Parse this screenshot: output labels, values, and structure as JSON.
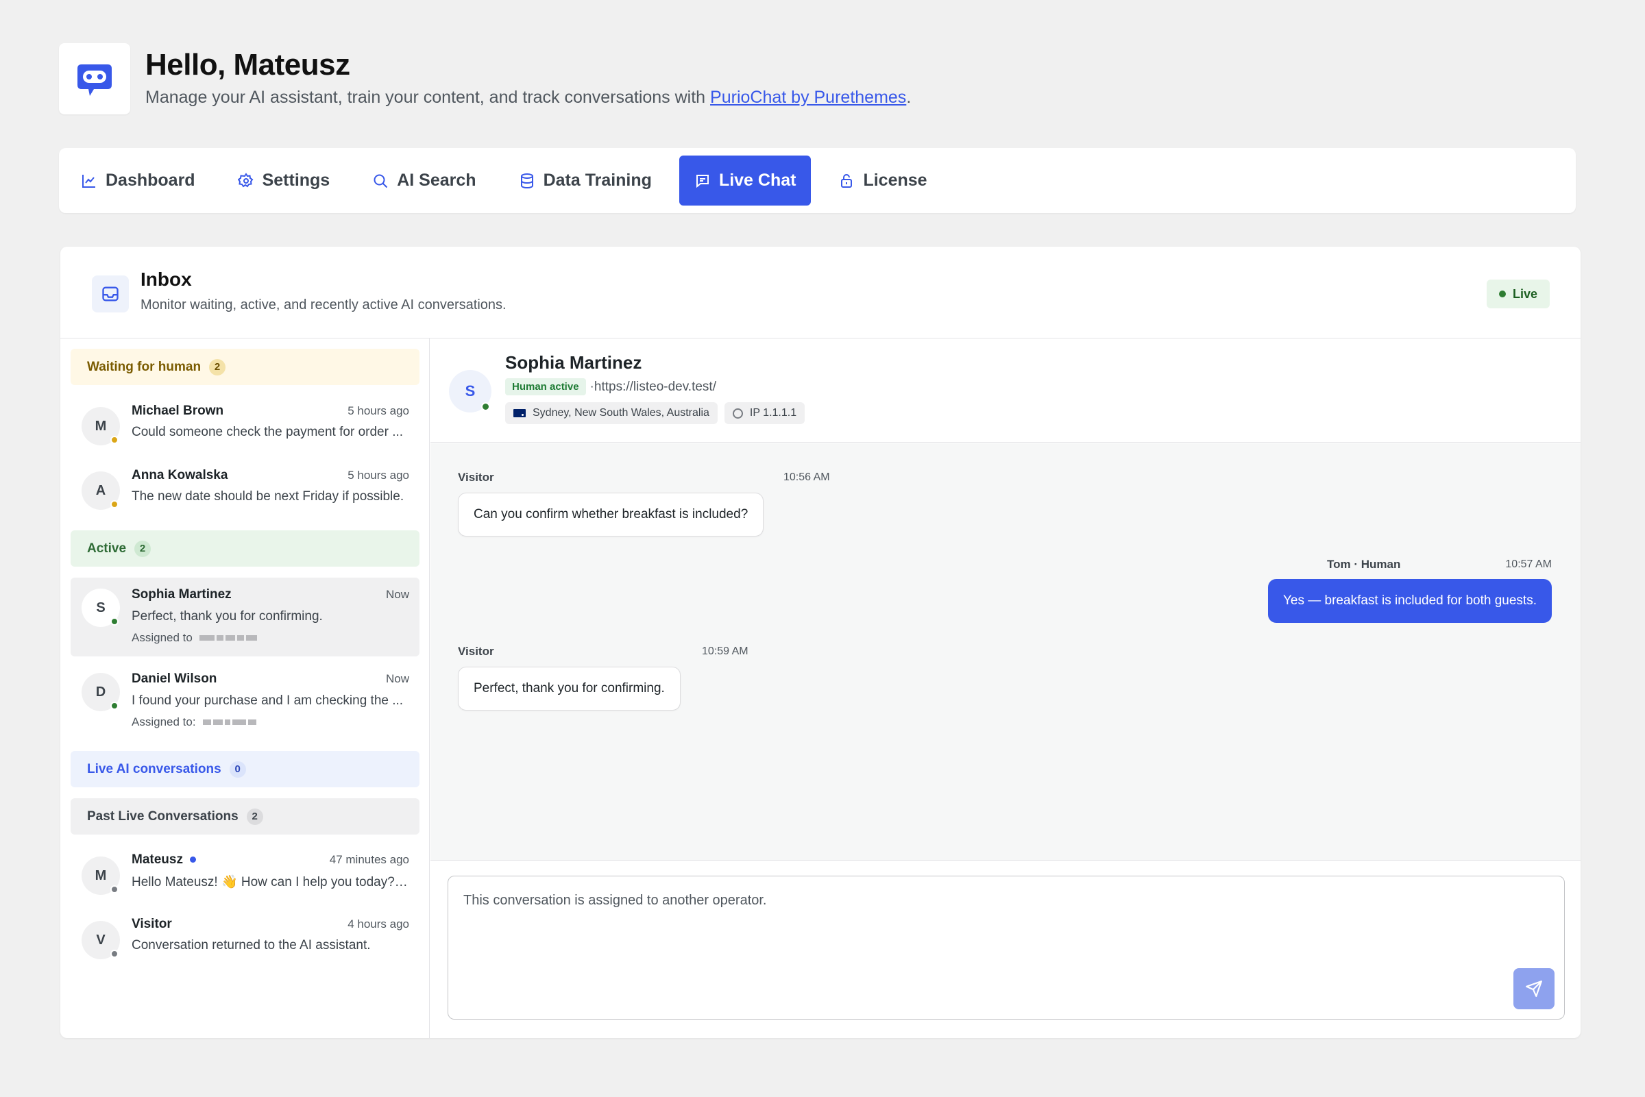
{
  "header": {
    "greeting": "Hello, Mateusz",
    "subtitle_prefix": "Manage your AI assistant, train your content, and track conversations with ",
    "subtitle_link": "PurioChat by Purethemes",
    "subtitle_suffix": "."
  },
  "nav": {
    "items": [
      {
        "label": "Dashboard",
        "icon": "chart-line-icon"
      },
      {
        "label": "Settings",
        "icon": "gear-icon"
      },
      {
        "label": "AI Search",
        "icon": "search-icon"
      },
      {
        "label": "Data Training",
        "icon": "database-icon"
      },
      {
        "label": "Live Chat",
        "icon": "chat-icon",
        "active": true
      },
      {
        "label": "License",
        "icon": "lock-icon"
      }
    ]
  },
  "inbox": {
    "title": "Inbox",
    "subtitle": "Monitor waiting, active, and recently active AI conversations.",
    "status": "Live"
  },
  "sections": {
    "waiting": {
      "label": "Waiting for human",
      "count": "2"
    },
    "active": {
      "label": "Active",
      "count": "2"
    },
    "live_ai": {
      "label": "Live AI conversations",
      "count": "0"
    },
    "past": {
      "label": "Past Live Conversations",
      "count": "2"
    }
  },
  "conversations": {
    "waiting": [
      {
        "initial": "M",
        "name": "Michael Brown",
        "time": "5 hours ago",
        "preview": "Could someone check the payment for order ..."
      },
      {
        "initial": "A",
        "name": "Anna Kowalska",
        "time": "5 hours ago",
        "preview": "The new date should be next Friday if possible."
      }
    ],
    "active": [
      {
        "initial": "S",
        "name": "Sophia Martinez",
        "time": "Now",
        "preview": "Perfect, thank you for confirming.",
        "assigned_label": "Assigned to"
      },
      {
        "initial": "D",
        "name": "Daniel Wilson",
        "time": "Now",
        "preview": "I found your purchase and I am checking the ...",
        "assigned_label": "Assigned to:"
      }
    ],
    "past": [
      {
        "initial": "M",
        "name": "Mateusz",
        "time": "47 minutes ago",
        "preview": "Hello Mateusz! 👋 How can I help you today? I ..."
      },
      {
        "initial": "V",
        "name": "Visitor",
        "time": "4 hours ago",
        "preview": "Conversation returned to the AI assistant."
      }
    ]
  },
  "chat": {
    "initial": "S",
    "name": "Sophia Martinez",
    "badge": "Human active",
    "url": "https://listeo-dev.test/",
    "location": "Sydney, New South Wales, Australia",
    "ip": "IP 1.1.1.1",
    "messages": [
      {
        "sender": "Visitor",
        "time": "10:56 AM",
        "text": "Can you confirm whether breakfast is included?"
      },
      {
        "sender": "Tom · Human",
        "time": "10:57 AM",
        "text": "Yes — breakfast is included for both guests."
      },
      {
        "sender": "Visitor",
        "time": "10:59 AM",
        "text": "Perfect, thank you for confirming."
      }
    ],
    "composer_placeholder": "This conversation is assigned to another operator."
  },
  "colors": {
    "accent": "#3858e9",
    "waiting_bg": "#fff8e6",
    "active_bg": "#e9f5ea",
    "live_bg": "#e8f5e9"
  }
}
